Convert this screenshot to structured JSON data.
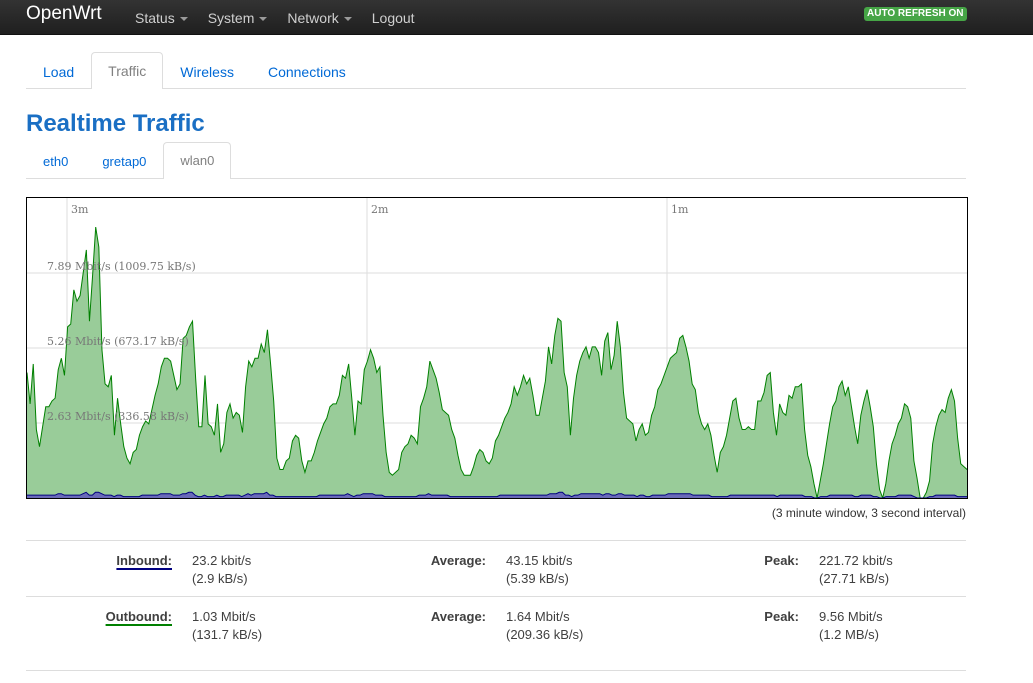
{
  "navbar": {
    "brand": "OpenWrt",
    "menu": [
      {
        "label": "Status",
        "dropdown": true
      },
      {
        "label": "System",
        "dropdown": true
      },
      {
        "label": "Network",
        "dropdown": true
      },
      {
        "label": "Logout",
        "dropdown": false
      }
    ],
    "auto_refresh": "AUTO REFRESH ON"
  },
  "tabs": {
    "items": [
      "Load",
      "Traffic",
      "Wireless",
      "Connections"
    ],
    "active": "Traffic"
  },
  "page_title": "Realtime Traffic",
  "interfaces": {
    "items": [
      "eth0",
      "gretap0",
      "wlan0"
    ],
    "active": "wlan0"
  },
  "chart": {
    "time_labels": [
      "3m",
      "2m",
      "1m"
    ],
    "y_labels": [
      "7.89 Mbit/s (1009.75 kB/s)",
      "5.26 Mbit/s (673.17 kB/s)",
      "2.63 Mbit/s (336.58 kB/s)"
    ],
    "note": "(3 minute window, 3 second interval)"
  },
  "chart_data": {
    "type": "area",
    "y_unit": "Mbit/s",
    "ylim": [
      0,
      10.52
    ],
    "y_ticks": [
      2.63,
      5.26,
      7.89
    ],
    "series": [
      {
        "name": "Outbound",
        "color": "#008000",
        "fill": "#99cc99",
        "values": [
          4.4,
          3.3,
          4.7,
          2.4,
          1.8,
          2.5,
          3.2,
          3.2,
          3.4,
          3.5,
          4.5,
          4.9,
          4.3,
          6.0,
          6.1,
          7.3,
          6.9,
          7.1,
          7.9,
          8.7,
          6.2,
          7.8,
          9.5,
          8.8,
          5.2,
          4.0,
          3.9,
          4.3,
          2.2,
          3.5,
          2.6,
          1.8,
          1.4,
          1.2,
          1.6,
          1.7,
          2.2,
          2.5,
          2.7,
          2.6,
          3.1,
          3.6,
          4.0,
          4.6,
          4.9,
          4.9,
          4.8,
          4.3,
          3.8,
          4.0,
          5.6,
          5.7,
          6.0,
          6.2,
          4.2,
          2.5,
          2.5,
          4.3,
          2.6,
          2.5,
          2.2,
          3.3,
          1.6,
          1.9,
          3.0,
          3.3,
          2.8,
          3.0,
          2.9,
          2.3,
          3.9,
          4.8,
          4.6,
          4.9,
          4.9,
          5.4,
          5.1,
          5.9,
          4.7,
          3.4,
          1.4,
          1.0,
          1.0,
          1.3,
          1.4,
          2.0,
          2.2,
          2.1,
          1.3,
          0.9,
          1.3,
          1.3,
          1.6,
          2.0,
          2.3,
          2.6,
          2.8,
          3.2,
          3.3,
          3.3,
          3.6,
          4.3,
          4.2,
          4.7,
          3.5,
          2.2,
          3.4,
          3.3,
          4.5,
          4.8,
          5.2,
          4.9,
          4.4,
          4.6,
          2.9,
          1.6,
          0.9,
          0.8,
          0.9,
          1.0,
          1.6,
          1.8,
          1.9,
          2.2,
          2.1,
          1.9,
          3.2,
          3.5,
          3.9,
          4.8,
          4.5,
          4.2,
          3.7,
          3.1,
          3.0,
          2.9,
          2.4,
          2.1,
          1.5,
          1.0,
          0.8,
          0.8,
          0.8,
          1.1,
          1.5,
          1.7,
          1.6,
          1.3,
          1.2,
          1.4,
          2.0,
          2.2,
          2.5,
          2.8,
          3.0,
          3.3,
          3.9,
          3.6,
          3.9,
          4.3,
          4.0,
          4.2,
          3.6,
          2.9,
          2.9,
          3.5,
          4.1,
          5.3,
          4.7,
          5.7,
          6.3,
          6.2,
          4.4,
          3.9,
          2.2,
          3.5,
          4.3,
          4.8,
          5.1,
          5.3,
          4.9,
          5.3,
          5.3,
          5.1,
          4.3,
          5.5,
          5.8,
          4.5,
          5.0,
          6.2,
          5.3,
          3.7,
          2.8,
          2.7,
          2.6,
          2.0,
          2.4,
          2.6,
          2.2,
          2.3,
          2.9,
          3.2,
          3.8,
          4.0,
          4.3,
          4.6,
          4.9,
          5.0,
          5.1,
          5.6,
          5.7,
          5.3,
          4.8,
          4.0,
          3.8,
          3.0,
          2.6,
          2.4,
          2.6,
          2.2,
          1.5,
          0.9,
          1.6,
          1.8,
          2.2,
          2.8,
          3.4,
          3.5,
          2.8,
          2.4,
          2.4,
          2.5,
          2.4,
          2.4,
          3.4,
          3.4,
          3.7,
          4.3,
          4.4,
          3.0,
          2.2,
          3.3,
          3.0,
          2.9,
          3.6,
          3.5,
          3.9,
          3.9,
          4.0,
          2.4,
          1.5,
          1.1,
          0.5,
          0.0,
          0.6,
          1.2,
          1.9,
          2.6,
          3.2,
          3.4,
          3.9,
          4.1,
          3.6,
          3.9,
          3.2,
          2.5,
          1.9,
          2.9,
          3.4,
          3.8,
          3.2,
          2.5,
          1.2,
          0.3,
          0.0,
          0.5,
          1.3,
          1.9,
          2.2,
          2.6,
          2.8,
          3.3,
          3.2,
          2.8,
          1.3,
          0.7,
          0.0,
          0.0,
          0.2,
          0.6,
          1.9,
          2.5,
          2.9,
          3.1,
          3.0,
          3.5,
          3.8,
          3.4,
          2.1,
          1.2,
          1.1,
          1.0
        ]
      },
      {
        "name": "Inbound",
        "color": "#000080",
        "fill": "#6a6ab8",
        "values": [
          0.1,
          0.1,
          0.1,
          0.1,
          0.1,
          0.1,
          0.1,
          0.1,
          0.1,
          0.1,
          0.15,
          0.15,
          0.1,
          0.1,
          0.1,
          0.1,
          0.1,
          0.1,
          0.15,
          0.2,
          0.1,
          0.1,
          0.2,
          0.2,
          0.15,
          0.1,
          0.1,
          0.1,
          0.05,
          0.1,
          0.1,
          0.05,
          0.05,
          0.05,
          0.05,
          0.05,
          0.05,
          0.1,
          0.1,
          0.1,
          0.1,
          0.1,
          0.1,
          0.15,
          0.15,
          0.15,
          0.15,
          0.1,
          0.1,
          0.1,
          0.15,
          0.15,
          0.2,
          0.2,
          0.1,
          0.05,
          0.05,
          0.1,
          0.05,
          0.05,
          0.05,
          0.1,
          0.05,
          0.05,
          0.1,
          0.1,
          0.1,
          0.1,
          0.1,
          0.05,
          0.1,
          0.15,
          0.1,
          0.15,
          0.15,
          0.15,
          0.15,
          0.2,
          0.1,
          0.1,
          0.05,
          0.05,
          0.05,
          0.05,
          0.05,
          0.05,
          0.05,
          0.05,
          0.05,
          0.05,
          0.05,
          0.05,
          0.05,
          0.05,
          0.1,
          0.1,
          0.1,
          0.1,
          0.1,
          0.1,
          0.1,
          0.1,
          0.1,
          0.15,
          0.1,
          0.05,
          0.1,
          0.1,
          0.15,
          0.15,
          0.15,
          0.15,
          0.1,
          0.1,
          0.1,
          0.05,
          0.05,
          0.05,
          0.05,
          0.05,
          0.05,
          0.05,
          0.05,
          0.05,
          0.05,
          0.05,
          0.1,
          0.1,
          0.1,
          0.15,
          0.1,
          0.1,
          0.1,
          0.1,
          0.1,
          0.1,
          0.05,
          0.05,
          0.05,
          0.05,
          0.05,
          0.05,
          0.05,
          0.05,
          0.05,
          0.05,
          0.05,
          0.05,
          0.05,
          0.05,
          0.05,
          0.05,
          0.1,
          0.1,
          0.1,
          0.1,
          0.1,
          0.1,
          0.1,
          0.1,
          0.1,
          0.1,
          0.1,
          0.1,
          0.1,
          0.1,
          0.1,
          0.1,
          0.15,
          0.15,
          0.15,
          0.2,
          0.2,
          0.1,
          0.1,
          0.05,
          0.1,
          0.1,
          0.15,
          0.15,
          0.15,
          0.15,
          0.15,
          0.15,
          0.15,
          0.1,
          0.15,
          0.15,
          0.1,
          0.1,
          0.15,
          0.15,
          0.1,
          0.1,
          0.1,
          0.1,
          0.05,
          0.1,
          0.1,
          0.05,
          0.05,
          0.1,
          0.1,
          0.1,
          0.1,
          0.1,
          0.15,
          0.15,
          0.15,
          0.15,
          0.15,
          0.15,
          0.15,
          0.15,
          0.1,
          0.1,
          0.1,
          0.1,
          0.1,
          0.1,
          0.05,
          0.05,
          0.05,
          0.05,
          0.05,
          0.05,
          0.1,
          0.1,
          0.1,
          0.1,
          0.1,
          0.1,
          0.1,
          0.1,
          0.1,
          0.1,
          0.1,
          0.1,
          0.1,
          0.1,
          0.1,
          0.05,
          0.1,
          0.1,
          0.1,
          0.1,
          0.1,
          0.1,
          0.1,
          0.1,
          0.05,
          0.05,
          0.05,
          0.0,
          0.0,
          0.05,
          0.05,
          0.05,
          0.1,
          0.1,
          0.1,
          0.1,
          0.1,
          0.1,
          0.1,
          0.1,
          0.05,
          0.05,
          0.1,
          0.1,
          0.1,
          0.1,
          0.05,
          0.05,
          0.0,
          0.0,
          0.05,
          0.05,
          0.05,
          0.05,
          0.1,
          0.1,
          0.1,
          0.1,
          0.1,
          0.05,
          0.0,
          0.0,
          0.0,
          0.0,
          0.05,
          0.05,
          0.1,
          0.1,
          0.1,
          0.1,
          0.1,
          0.1,
          0.1,
          0.05,
          0.05,
          0.05,
          0.05
        ]
      }
    ]
  },
  "stats": {
    "inbound": {
      "label": "Inbound:",
      "current": "23.2 kbit/s",
      "current_kb": "(2.9 kB/s)",
      "avg_label": "Average:",
      "average": "43.15 kbit/s",
      "average_kb": "(5.39 kB/s)",
      "peak_label": "Peak:",
      "peak": "221.72 kbit/s",
      "peak_kb": "(27.71 kB/s)"
    },
    "outbound": {
      "label": "Outbound:",
      "current": "1.03 Mbit/s",
      "current_kb": "(131.7 kB/s)",
      "avg_label": "Average:",
      "average": "1.64 Mbit/s",
      "average_kb": "(209.36 kB/s)",
      "peak_label": "Peak:",
      "peak": "9.56 Mbit/s",
      "peak_kb": "(1.2 MB/s)"
    }
  }
}
